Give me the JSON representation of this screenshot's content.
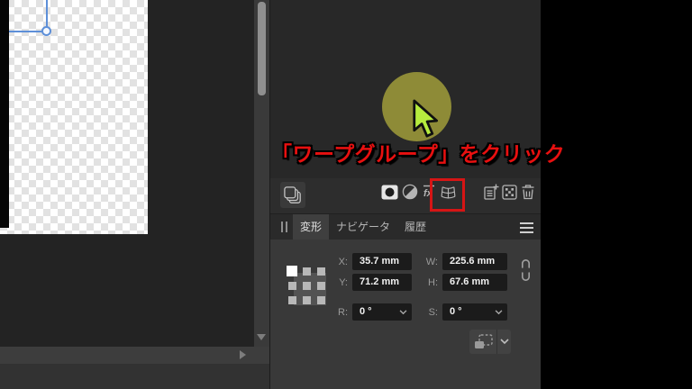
{
  "callout": {
    "text": "「ワープグループ」をクリック"
  },
  "colors": {
    "accent_red": "#d61515",
    "callout_red": "#e81010",
    "highlight_circle_fill": "#8e8b37",
    "cursor_green": "#b6ec3e",
    "selection_blue": "#5d8fd8",
    "panel_bg": "#2d2d2d",
    "field_bg": "#1b1b1b"
  },
  "layers_toolbar": {
    "icons": [
      "layers-icon",
      "mask-icon",
      "adjustment-icon",
      "fx-icon",
      "warp-group-icon",
      "add-layer-icon",
      "pattern-icon",
      "delete-icon"
    ],
    "highlighted_icon": "warp-group-icon"
  },
  "studio_tabs": [
    {
      "label": "変形",
      "active": true
    },
    {
      "label": "ナビゲータ",
      "active": false
    },
    {
      "label": "履歴",
      "active": false
    }
  ],
  "transform_panel": {
    "fields": {
      "x": {
        "label": "X:",
        "value": "35.7 mm"
      },
      "y": {
        "label": "Y:",
        "value": "71.2 mm"
      },
      "w": {
        "label": "W:",
        "value": "225.6 mm"
      },
      "h": {
        "label": "H:",
        "value": "67.6 mm"
      },
      "r": {
        "label": "R:",
        "value": "0 °"
      },
      "s": {
        "label": "S:",
        "value": "0 °"
      }
    }
  }
}
